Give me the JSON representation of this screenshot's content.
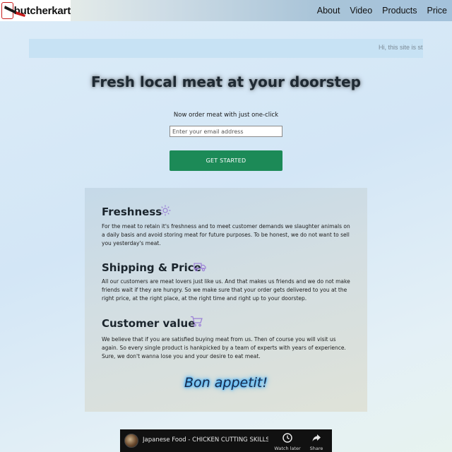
{
  "navbar": {
    "logo_text": "butcherkart",
    "links": [
      "About",
      "Video",
      "Products",
      "Price"
    ]
  },
  "banner": {
    "text": "Hi, this site is still"
  },
  "hero": {
    "title": "Fresh local meat at your doorstep",
    "subtitle": "Now order meat with just one-click",
    "email_placeholder": "Enter your email address",
    "cta_label": "GET STARTED"
  },
  "features": [
    {
      "title": "Freshness",
      "icon": "sun-icon",
      "text": "For the meat to retain it's freshness and to meet customer demands we slaughter animals on a daily basis and avoid storing meat for future purposes. To be honest, we do not want to sell you yesterday's meat."
    },
    {
      "title": "Shipping & Price",
      "icon": "truck-icon",
      "text": "All our customers are meat lovers just like us. And that makes us friends and we do not make friends wait if they are hungry. So we make sure that your order gets delivered to you at the right price, at the right place, at the right time and right up to your doorstep."
    },
    {
      "title": "Customer value",
      "icon": "cart-icon",
      "text": "We believe that if you are satisfied buying meat from us. Then of course you will visit us again. So every single product is hankpicked by a team of experts with years of experience. Sure, we don't wanna lose you and your desire to eat meat."
    }
  ],
  "tagline": "Bon appetit!",
  "video": {
    "title": "Japanese Food - CHICKEN CUTTING SKILLS...",
    "watch_later_label": "Watch later",
    "share_label": "Share"
  },
  "colors": {
    "cta": "#1c8a57",
    "icon_accent": "#9b7fd6",
    "banner": "#c7e2f4"
  }
}
